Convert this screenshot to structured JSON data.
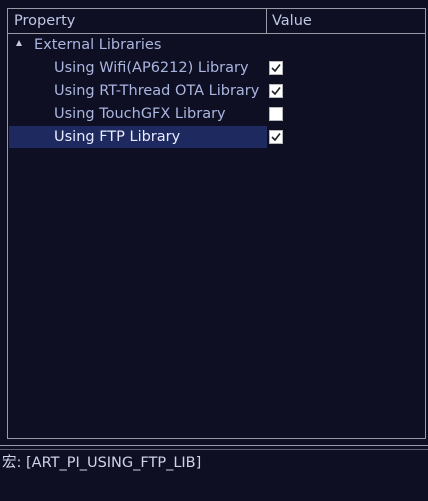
{
  "grid": {
    "columns": {
      "property": "Property",
      "value": "Value"
    },
    "group": {
      "label": "External Libraries",
      "expanded": true
    },
    "items": [
      {
        "label": "Using Wifi(AP6212) Library",
        "checked": true
      },
      {
        "label": "Using RT-Thread OTA Library",
        "checked": true
      },
      {
        "label": "Using TouchGFX Library",
        "checked": false
      },
      {
        "label": "Using FTP Library",
        "checked": true,
        "selected": true
      }
    ]
  },
  "description": {
    "text": "宏: [ART_PI_USING_FTP_LIB]"
  },
  "colors": {
    "background": "#0f0f24",
    "text": "#aab6df",
    "selection": "#1e2a5f",
    "border": "#9a9aa6"
  }
}
